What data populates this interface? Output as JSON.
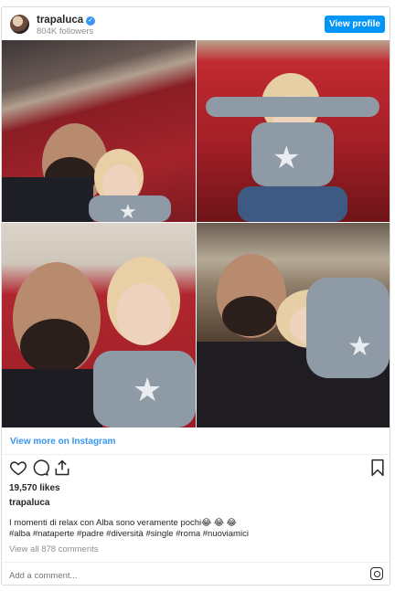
{
  "header": {
    "username": "trapaluca",
    "followers": "804K followers",
    "view_profile_label": "View profile"
  },
  "photos": [
    {
      "description_icon": "photo-man-and-child"
    },
    {
      "description_icon": "photo-child-on-sofa"
    },
    {
      "description_icon": "photo-man-and-child-closeup"
    },
    {
      "description_icon": "photo-child-leaning-on-man"
    }
  ],
  "link": {
    "label": "View more on Instagram"
  },
  "actions": {
    "icons": [
      "heart-icon",
      "comment-icon",
      "share-icon",
      "bookmark-icon"
    ]
  },
  "likes": "19,570 likes",
  "caption": {
    "username": "trapaluca",
    "text": "I momenti di relax con Alba sono veramente pochi😂 😂 😂",
    "hashtags": "#alba #nataperte #padre #diversità #single #roma #nuoviamici"
  },
  "comments_link": "View all 878 comments",
  "comment_input": {
    "placeholder": "Add a comment..."
  },
  "colors": {
    "accent": "#3897f0",
    "button": "#0095f6"
  }
}
